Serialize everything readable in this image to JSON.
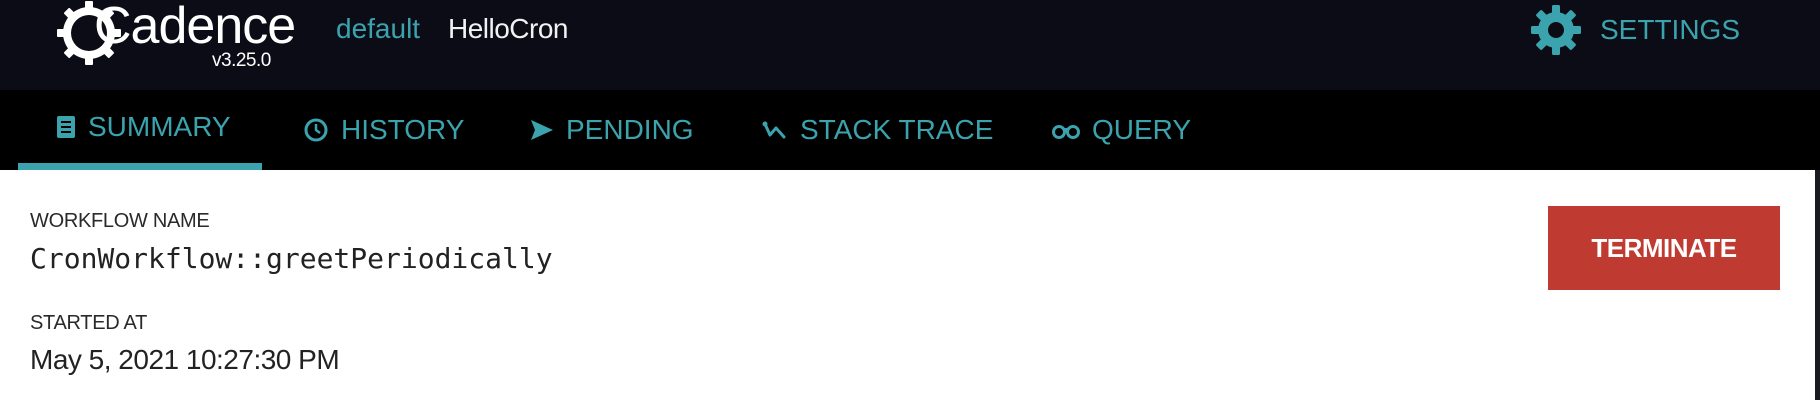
{
  "app": {
    "name": "Cadence",
    "version": "v3.25.0"
  },
  "breadcrumb": {
    "domain": "default",
    "workflow": "HelloCron"
  },
  "settings": {
    "label": "SETTINGS",
    "icon": "gear-icon"
  },
  "tabs": [
    {
      "label": "SUMMARY",
      "icon": "summary-icon",
      "active": true
    },
    {
      "label": "HISTORY",
      "icon": "history-icon",
      "active": false
    },
    {
      "label": "PENDING",
      "icon": "pending-icon",
      "active": false
    },
    {
      "label": "STACK TRACE",
      "icon": "stack-trace-icon",
      "active": false
    },
    {
      "label": "QUERY",
      "icon": "query-icon",
      "active": false
    }
  ],
  "summary": {
    "workflow_name_label": "WORKFLOW NAME",
    "workflow_name": "CronWorkflow::greetPeriodically",
    "started_at_label": "STARTED AT",
    "started_at": "May 5, 2021 10:27:30 PM"
  },
  "actions": {
    "terminate_label": "TERMINATE"
  },
  "colors": {
    "topbar_bg": "#0c0c17",
    "tabbar_bg": "#000000",
    "accent": "#3ba3ad",
    "terminate_bg": "#bf3a30"
  }
}
